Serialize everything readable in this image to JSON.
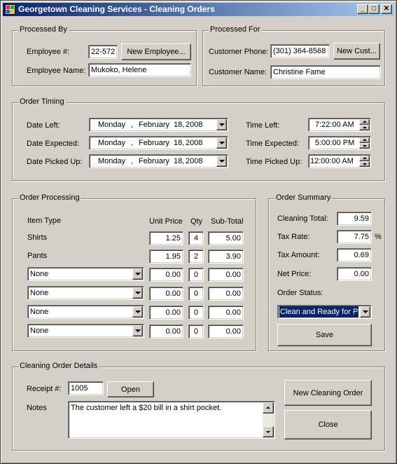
{
  "window": {
    "title": "Georgetown Cleaning Services - Cleaning Orders",
    "min_glyph": "_",
    "max_glyph": "□",
    "close_glyph": "✕"
  },
  "processed_by": {
    "title": "Processed By",
    "employee_num_label": "Employee #:",
    "employee_num": "22-572",
    "new_employee_button": "New Employee...",
    "employee_name_label": "Employee Name:",
    "employee_name": "Mukoko, Helene"
  },
  "processed_for": {
    "title": "Processed For",
    "customer_phone_label": "Customer Phone:",
    "customer_phone": "(301) 364-8568",
    "new_customer_button": "New Cust...",
    "customer_name_label": "Customer Name:",
    "customer_name": "Christine Fame"
  },
  "order_timing": {
    "title": "Order Timing",
    "dates": [
      {
        "label": "Date Left:",
        "day": "Monday",
        "comma": ",",
        "month": "February",
        "date": "18,",
        "year": "2008"
      },
      {
        "label": "Date Expected:",
        "day": "Monday",
        "comma": ",",
        "month": "February",
        "date": "18,",
        "year": "2008"
      },
      {
        "label": "Date Picked Up:",
        "day": "Monday",
        "comma": ",",
        "month": "February",
        "date": "18,",
        "year": "2008"
      }
    ],
    "times": [
      {
        "label": "Time Left:",
        "value": "7:22:00 AM"
      },
      {
        "label": "Time Expected:",
        "value": "5:00:00 PM"
      },
      {
        "label": "Time Picked Up:",
        "value": "12:00:00 AM"
      }
    ]
  },
  "order_processing": {
    "title": "Order Processing",
    "headers": {
      "item_type": "Item Type",
      "unit_price": "Unit Price",
      "qty": "Qty",
      "subtotal": "Sub-Total"
    },
    "fixed_items": [
      {
        "name": "Shirts",
        "unit_price": "1.25",
        "qty": "4",
        "subtotal": "5.00"
      },
      {
        "name": "Pants",
        "unit_price": "1.95",
        "qty": "2",
        "subtotal": "3.90"
      }
    ],
    "combo_items": [
      {
        "selected": "None",
        "unit_price": "0.00",
        "qty": "0",
        "subtotal": "0.00"
      },
      {
        "selected": "None",
        "unit_price": "0.00",
        "qty": "0",
        "subtotal": "0.00"
      },
      {
        "selected": "None",
        "unit_price": "0.00",
        "qty": "0",
        "subtotal": "0.00"
      },
      {
        "selected": "None",
        "unit_price": "0.00",
        "qty": "0",
        "subtotal": "0.00"
      }
    ]
  },
  "order_summary": {
    "title": "Order Summary",
    "cleaning_total_label": "Cleaning Total:",
    "cleaning_total": "9.59",
    "tax_rate_label": "Tax Rate:",
    "tax_rate": "7.75",
    "percent_sign": "%",
    "tax_amount_label": "Tax Amount:",
    "tax_amount": "0.69",
    "net_price_label": "Net Price:",
    "net_price": "0.00",
    "order_status_label": "Order Status:",
    "order_status": "Clean and Ready for Pic",
    "save_button": "Save",
    "status_highlight_color": "#0a246a"
  },
  "details": {
    "title": "Cleaning Order Details",
    "receipt_label": "Receipt #:",
    "receipt_num": "1005",
    "open_button": "Open",
    "notes_label": "Notes",
    "notes": "The customer left a $20 bill in a shirt pocket.",
    "new_order_button": "New Cleaning Order",
    "close_button": "Close"
  }
}
